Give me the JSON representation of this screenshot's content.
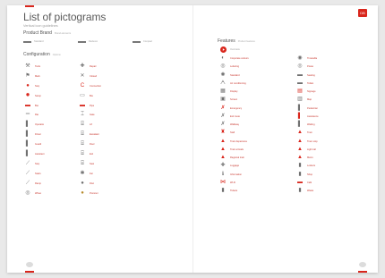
{
  "left": {
    "title": "List of pictograms",
    "subtitle": "Vertical icon guidelines",
    "product_brand": {
      "heading": "Product Brand",
      "sub": "Brand elements",
      "items": [
        {
          "icon": "bar-grey",
          "label": "Standard"
        },
        {
          "icon": "bar-grey",
          "label": "Reduced"
        },
        {
          "icon": "bar-grey",
          "label": "Compact"
        }
      ]
    },
    "configuration": {
      "heading": "Configuration",
      "sub": "Options",
      "col1": [
        {
          "icon": "tool-icon",
          "glyph": "⚒",
          "color": "grey",
          "label": "Tools"
        },
        {
          "icon": "flag-icon",
          "glyph": "⚑",
          "color": "grey",
          "label": "Mark"
        },
        {
          "icon": "stop-icon",
          "glyph": "●",
          "color": "red",
          "label": "Stop"
        },
        {
          "icon": "gear-icon",
          "glyph": "✹",
          "color": "red",
          "label": "Setup"
        },
        {
          "icon": "bus-icon",
          "glyph": "▬",
          "color": "red",
          "label": "Bus"
        },
        {
          "icon": "rail-icon",
          "glyph": "═",
          "color": "grey",
          "label": "Rail"
        },
        {
          "icon": "person-icon",
          "glyph": "▌",
          "color": "grey",
          "label": "Operator"
        },
        {
          "icon": "person-icon",
          "glyph": "▌",
          "color": "grey",
          "label": "Driver"
        },
        {
          "icon": "person-icon",
          "glyph": "▌",
          "color": "grey",
          "label": "Guard"
        },
        {
          "icon": "person-icon",
          "glyph": "▌",
          "color": "grey",
          "label": "Assistant"
        },
        {
          "icon": "step-icon",
          "glyph": "⟋",
          "color": "grey",
          "label": "Step"
        },
        {
          "icon": "step-icon",
          "glyph": "⟋",
          "color": "grey",
          "label": "Stairs"
        },
        {
          "icon": "ramp-icon",
          "glyph": "⟋",
          "color": "grey",
          "label": "Ramp"
        },
        {
          "icon": "wheel-icon",
          "glyph": "◎",
          "color": "grey",
          "label": "Wheel"
        }
      ],
      "col2": [
        {
          "icon": "wrench-icon",
          "glyph": "✚",
          "color": "grey",
          "label": "Repair"
        },
        {
          "icon": "close-icon",
          "glyph": "✕",
          "color": "grey",
          "label": "Closed"
        },
        {
          "icon": "hook-icon",
          "glyph": "C",
          "color": "red",
          "label": "Connection"
        },
        {
          "icon": "box-icon",
          "glyph": "▭",
          "color": "grey",
          "label": "Box"
        },
        {
          "icon": "pipe-icon",
          "glyph": "▬",
          "color": "red",
          "label": "Pipe"
        },
        {
          "icon": "gate-icon",
          "glyph": "⌶",
          "color": "grey",
          "label": "Gate"
        },
        {
          "icon": "lift-icon",
          "glyph": "⌸",
          "color": "grey",
          "label": "Lift"
        },
        {
          "icon": "escalator-icon",
          "glyph": "⌸",
          "color": "grey",
          "label": "Escalator"
        },
        {
          "icon": "door-icon",
          "glyph": "⌸",
          "color": "grey",
          "label": "Door"
        },
        {
          "icon": "exit-icon",
          "glyph": "⌸",
          "color": "grey",
          "label": "Exit"
        },
        {
          "icon": "seat-icon",
          "glyph": "⌸",
          "color": "grey",
          "label": "Seat"
        },
        {
          "icon": "fan-icon",
          "glyph": "✱",
          "color": "grey",
          "label": "Fan"
        },
        {
          "icon": "disc-icon",
          "glyph": "●",
          "color": "grey",
          "label": "Disc"
        },
        {
          "icon": "gold-disc-icon",
          "glyph": "●",
          "color": "gold",
          "label": "Premium"
        }
      ]
    }
  },
  "right": {
    "features": {
      "heading": "Features",
      "sub": "Product features",
      "top_item": {
        "icon": "play-icon",
        "label": "Overview"
      },
      "col1": [
        {
          "icon": "c-icon",
          "glyph": "◐",
          "color": "grey",
          "label": "Corporate colours"
        },
        {
          "icon": "target-icon",
          "glyph": "◎",
          "color": "grey",
          "label": "Lettering"
        },
        {
          "icon": "star-icon",
          "glyph": "✺",
          "color": "grey",
          "label": "Standard"
        },
        {
          "icon": "ac-icon",
          "glyph": "ᗅ",
          "color": "grey",
          "label": "Air conditioning"
        },
        {
          "icon": "grid-icon",
          "glyph": "▦",
          "color": "grey",
          "label": "Display"
        },
        {
          "icon": "tv-icon",
          "glyph": "▣",
          "color": "grey",
          "label": "Screen"
        },
        {
          "icon": "runner-icon",
          "glyph": "✗",
          "color": "red",
          "label": "Emergency"
        },
        {
          "icon": "run-icon",
          "glyph": "✗",
          "color": "grey",
          "label": "Exit route"
        },
        {
          "icon": "walk-icon",
          "glyph": "✗",
          "color": "grey",
          "label": "Walkway"
        },
        {
          "icon": "person-red-icon",
          "glyph": "♜",
          "color": "red",
          "label": "Staff"
        },
        {
          "icon": "train-icon",
          "glyph": "▲",
          "color": "red",
          "label": "Train departures"
        },
        {
          "icon": "train-icon",
          "glyph": "▲",
          "color": "red",
          "label": "Train arrivals"
        },
        {
          "icon": "train-icon",
          "glyph": "▲",
          "color": "red",
          "label": "Regional train"
        },
        {
          "icon": "bag-icon",
          "glyph": "✚",
          "color": "grey",
          "label": "Luggage"
        },
        {
          "icon": "info-icon",
          "glyph": "ℹ",
          "color": "grey",
          "label": "Information"
        },
        {
          "icon": "wifi-icon",
          "glyph": "⋈",
          "color": "red",
          "label": "Wi-Fi"
        },
        {
          "icon": "ticket-icon",
          "glyph": "▮",
          "color": "grey",
          "label": "Tickets"
        }
      ],
      "col2": [
        {
          "icon": "clock-icon",
          "glyph": "◉",
          "color": "grey",
          "label": "Timetable"
        },
        {
          "icon": "power-icon",
          "glyph": "◎",
          "color": "grey",
          "label": "Power"
        },
        {
          "icon": "seat-icon",
          "glyph": "▬",
          "color": "grey",
          "label": "Seating"
        },
        {
          "icon": "wc-icon",
          "glyph": "▬",
          "color": "grey",
          "label": "Toilets"
        },
        {
          "icon": "sign-icon",
          "glyph": "▤",
          "color": "red",
          "label": "Signage"
        },
        {
          "icon": "map-icon",
          "glyph": "▥",
          "color": "grey",
          "label": "Map"
        },
        {
          "icon": "person-icon",
          "glyph": "▌",
          "color": "grey",
          "label": "Pedestrian"
        },
        {
          "icon": "person-icon",
          "glyph": "▌",
          "color": "red",
          "label": "Assistance"
        },
        {
          "icon": "person-icon",
          "glyph": "▌",
          "color": "grey",
          "label": "Waiting"
        },
        {
          "icon": "tram-icon",
          "glyph": "▲",
          "color": "red",
          "label": "Tram"
        },
        {
          "icon": "tram-icon",
          "glyph": "▲",
          "color": "red",
          "label": "Tram stop"
        },
        {
          "icon": "tram-icon",
          "glyph": "▲",
          "color": "red",
          "label": "Light rail"
        },
        {
          "icon": "tram-icon",
          "glyph": "▲",
          "color": "red",
          "label": "Metro"
        },
        {
          "icon": "bag-icon",
          "glyph": "▮",
          "color": "grey",
          "label": "Lockers"
        },
        {
          "icon": "shop-icon",
          "glyph": "▮",
          "color": "grey",
          "label": "Shop"
        },
        {
          "icon": "cafe-icon",
          "glyph": "▬",
          "color": "red",
          "label": "Café"
        },
        {
          "icon": "bin-icon",
          "glyph": "▮",
          "color": "grey",
          "label": "Waste"
        }
      ]
    }
  },
  "colors": {
    "accent": "#d9261c",
    "grey_icon": "#707070",
    "gold": "#b68a2a"
  },
  "logo_badge": "DB"
}
